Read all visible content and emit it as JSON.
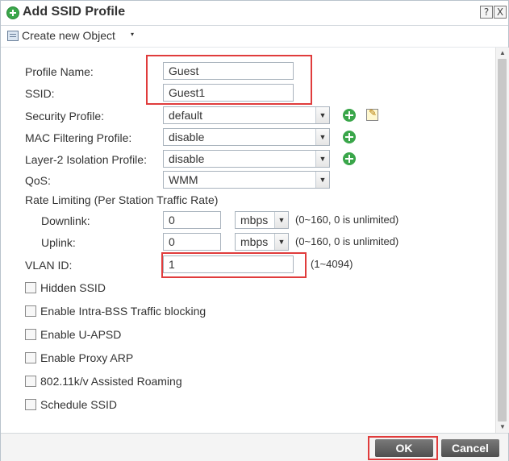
{
  "dialog": {
    "title": "Add SSID Profile",
    "help_btn": "?",
    "close_btn": "X"
  },
  "toolbar": {
    "create_label": "Create new Object",
    "create_arrow": "▾"
  },
  "form": {
    "profile_name": {
      "label": "Profile Name:",
      "value": "Guest"
    },
    "ssid": {
      "label": "SSID:",
      "value": "Guest1"
    },
    "security_profile": {
      "label": "Security Profile:",
      "value": "default"
    },
    "mac_filtering": {
      "label": "MAC Filtering Profile:",
      "value": "disable"
    },
    "layer2_isolation": {
      "label": "Layer-2 Isolation Profile:",
      "value": "disable"
    },
    "qos": {
      "label": "QoS:",
      "value": "WMM"
    },
    "rate_limiting": {
      "label": "Rate Limiting (Per Station Traffic Rate)",
      "downlink": {
        "label": "Downlink:",
        "value": "0",
        "unit": "mbps",
        "hint": "(0~160, 0 is unlimited)"
      },
      "uplink": {
        "label": "Uplink:",
        "value": "0",
        "unit": "mbps",
        "hint": "(0~160, 0 is unlimited)"
      }
    },
    "vlan_id": {
      "label": "VLAN ID:",
      "value": "1",
      "hint": "(1~4094)"
    },
    "checkboxes": [
      {
        "label": "Hidden SSID",
        "checked": false
      },
      {
        "label": "Enable Intra-BSS Traffic blocking",
        "checked": false
      },
      {
        "label": "Enable U-APSD",
        "checked": false
      },
      {
        "label": "Enable Proxy ARP",
        "checked": false
      },
      {
        "label": "802.11k/v Assisted Roaming",
        "checked": false
      },
      {
        "label": "Schedule SSID",
        "checked": false
      }
    ]
  },
  "footer": {
    "ok_label": "OK",
    "cancel_label": "Cancel"
  },
  "colors": {
    "highlight": "#e03c3c",
    "add_icon": "#3aa64a",
    "button": "#5a5a5a"
  }
}
